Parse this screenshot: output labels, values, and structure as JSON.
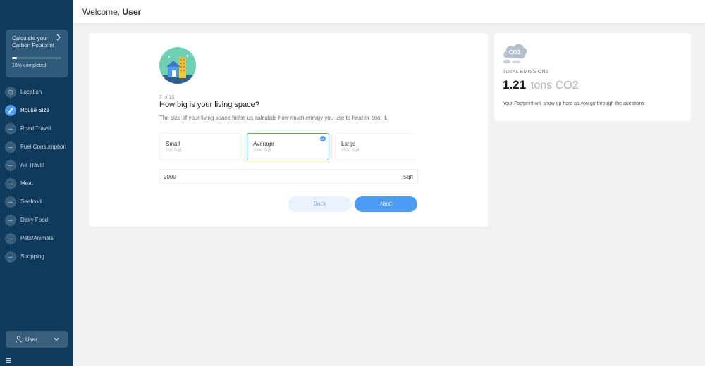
{
  "header": {
    "greeting": "Welcome,",
    "user_name": "User"
  },
  "sidebar": {
    "progress": {
      "title": "Calculate your Carbon Footprint",
      "percent": 10,
      "text": "10% completed"
    },
    "steps": [
      {
        "label": "Location",
        "state": "done"
      },
      {
        "label": "House Size",
        "state": "active"
      },
      {
        "label": "Road Travel",
        "state": "pending"
      },
      {
        "label": "Fuel Consumption",
        "state": "pending"
      },
      {
        "label": "Air Travel",
        "state": "pending"
      },
      {
        "label": "Meat",
        "state": "pending"
      },
      {
        "label": "Seafood",
        "state": "pending"
      },
      {
        "label": "Dairy Food",
        "state": "pending"
      },
      {
        "label": "Pets/Animals",
        "state": "pending"
      },
      {
        "label": "Shopping",
        "state": "pending"
      }
    ],
    "user_menu": {
      "label": "User"
    }
  },
  "question": {
    "step_text": "2 of 10",
    "title": "How big is your living space?",
    "description": "The size of your living space helps us calculate how much energy you use to heat or cool it.",
    "options": [
      {
        "label": "Small",
        "size": "700 Sqft",
        "selected": false
      },
      {
        "label": "Average",
        "size": "2000 Sqft",
        "selected": true
      },
      {
        "label": "Large",
        "size": "3500 Sqft",
        "selected": false
      }
    ],
    "input_value": "2000",
    "input_unit": "Sqft",
    "back_label": "Back",
    "next_label": "Next"
  },
  "emissions": {
    "icon_text": "CO2",
    "label": "TOTAL EMISSIONS",
    "value": "1.21",
    "unit": "tons CO2",
    "note": "Your Footprint will show up here as you go through the questions"
  },
  "colors": {
    "sidebar": "#0f3a5c",
    "accent": "#4c9cf5",
    "background": "#f1f1f1"
  }
}
